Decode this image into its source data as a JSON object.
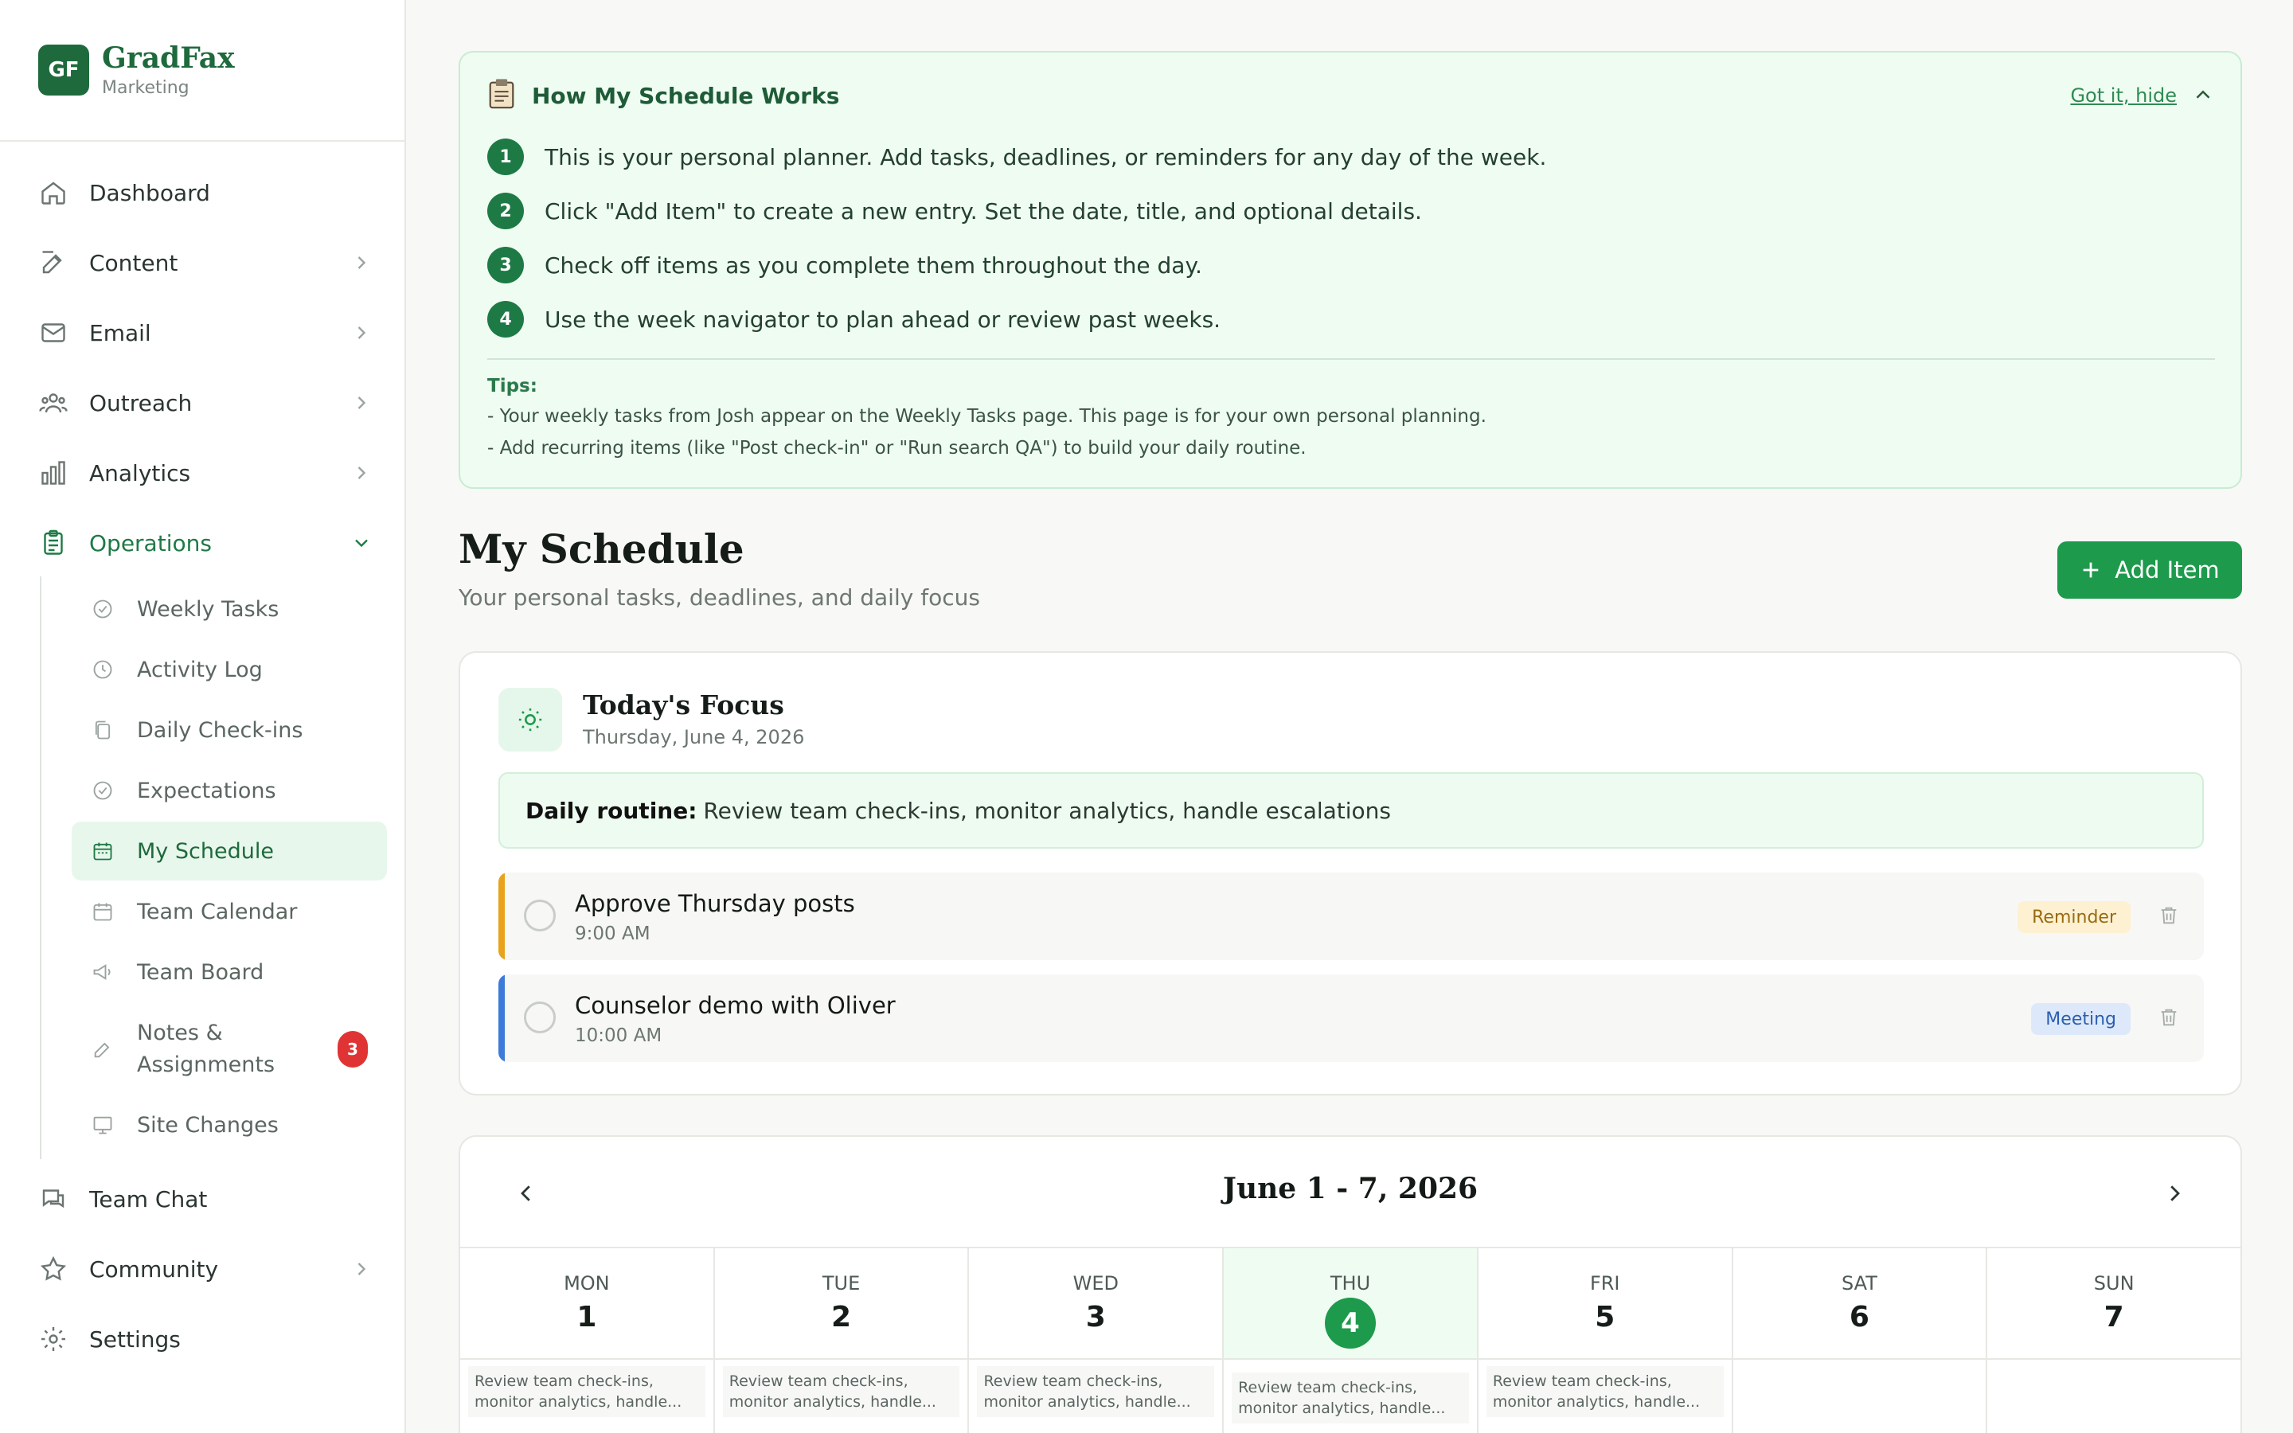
{
  "brand": {
    "logo": "GF",
    "name": "GradFax",
    "subtitle": "Marketing"
  },
  "nav": {
    "dashboard": "Dashboard",
    "content": "Content",
    "email": "Email",
    "outreach": "Outreach",
    "analytics": "Analytics",
    "operations": "Operations",
    "team_chat": "Team Chat",
    "community": "Community",
    "settings": "Settings"
  },
  "subnav": {
    "weekly_tasks": "Weekly Tasks",
    "activity_log": "Activity Log",
    "daily_checkins": "Daily Check-ins",
    "expectations": "Expectations",
    "my_schedule": "My Schedule",
    "team_calendar": "Team Calendar",
    "team_board": "Team Board",
    "notes_line1": "Notes &",
    "notes_line2": "Assignments",
    "notes_badge": "3",
    "site_changes": "Site Changes"
  },
  "info": {
    "title": "How My Schedule Works",
    "hide": "Got it, hide",
    "steps": [
      {
        "n": "1",
        "text": "This is your personal planner. Add tasks, deadlines, or reminders for any day of the week."
      },
      {
        "n": "2",
        "text": "Click \"Add Item\" to create a new entry. Set the date, title, and optional details."
      },
      {
        "n": "3",
        "text": "Check off items as you complete them throughout the day."
      },
      {
        "n": "4",
        "text": "Use the week navigator to plan ahead or review past weeks."
      }
    ],
    "tips_title": "Tips:",
    "tips": [
      "-  Your weekly tasks from Josh appear on the Weekly Tasks page. This page is for your own personal planning.",
      "-  Add recurring items (like \"Post check-in\" or \"Run search QA\") to build your daily routine."
    ]
  },
  "page": {
    "title": "My Schedule",
    "subtitle": "Your personal tasks, deadlines, and daily focus",
    "add_button": "Add Item"
  },
  "focus": {
    "title": "Today's Focus",
    "date": "Thursday, June 4, 2026",
    "routine_label": "Daily routine:",
    "routine_text": "Review team check-ins, monitor analytics, handle escalations",
    "tasks": [
      {
        "title": "Approve Thursday posts",
        "time": "9:00 AM",
        "tag": "Reminder",
        "color": "#e8a21b",
        "tag_bg": "#fdf1d2",
        "tag_fg": "#9a6a10"
      },
      {
        "title": "Counselor demo with Oliver",
        "time": "10:00 AM",
        "tag": "Meeting",
        "color": "#3c7bd9",
        "tag_bg": "#dde9fb",
        "tag_fg": "#2c5fae"
      }
    ]
  },
  "week": {
    "title": "June 1 - 7, 2026",
    "days": [
      {
        "name": "MON",
        "num": "1",
        "routine": "Review team check-ins, monitor analytics, handle..."
      },
      {
        "name": "TUE",
        "num": "2",
        "routine": "Review team check-ins, monitor analytics, handle..."
      },
      {
        "name": "WED",
        "num": "3",
        "routine": "Review team check-ins, monitor analytics, handle..."
      },
      {
        "name": "THU",
        "num": "4",
        "routine": "Review team check-ins, monitor analytics, handle..."
      },
      {
        "name": "FRI",
        "num": "5",
        "routine": "Review team check-ins, monitor analytics, handle..."
      },
      {
        "name": "SAT",
        "num": "6",
        "routine": ""
      },
      {
        "name": "SUN",
        "num": "7",
        "routine": ""
      }
    ]
  },
  "colors": {
    "brand": "#1e6a3c",
    "accent": "#1e9a4c",
    "active_bg": "#e8f7ec"
  }
}
